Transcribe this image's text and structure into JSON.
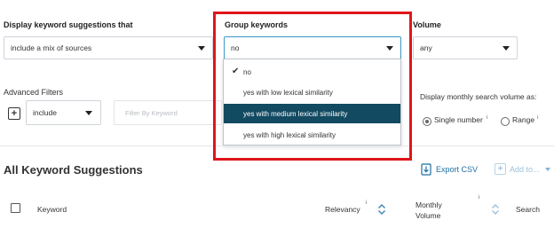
{
  "display": {
    "label": "Display keyword suggestions that",
    "value": "include a mix of sources"
  },
  "group": {
    "label": "Group keywords",
    "value": "no",
    "options": [
      "no",
      "yes with low lexical similarity",
      "yes with medium lexical similarity",
      "yes with high lexical similarity"
    ],
    "highlighted_option": "yes with medium lexical similarity",
    "selected_option": "no"
  },
  "volume": {
    "label": "Volume",
    "value": "any"
  },
  "advanced": {
    "label": "Advanced Filters",
    "include_value": "include",
    "filter_placeholder": "Filter By Keyword"
  },
  "monthly": {
    "label": "Display monthly search volume as:",
    "option_single": "Single number",
    "option_range": "Range",
    "info_mark": "i",
    "selected": "Single number"
  },
  "suggestions": {
    "title": "All Keyword Suggestions",
    "export_label": "Export CSV",
    "addto_label": "Add to...",
    "columns": {
      "keyword": "Keyword",
      "relevancy": "Relevancy",
      "monthly_line1": "Monthly",
      "monthly_line2": "Volume",
      "search": "Search"
    },
    "info_mark": "i"
  },
  "colors": {
    "highlight_border": "#e0151b",
    "option_highlight_bg": "#124a62",
    "link": "#1f6fa5",
    "focus_border": "#3f95c5"
  }
}
